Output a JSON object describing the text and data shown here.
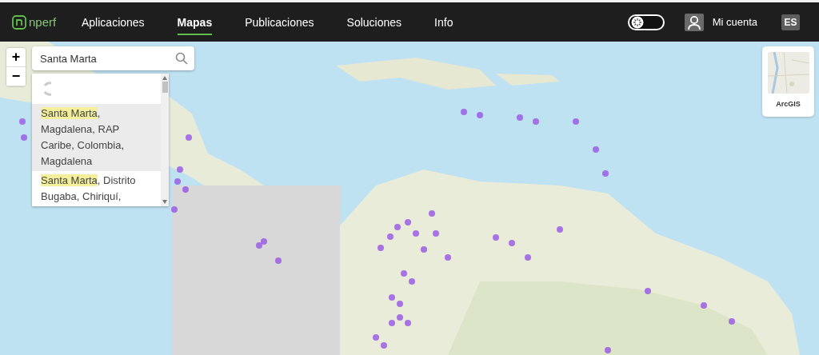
{
  "header": {
    "logo": "nperf",
    "nav": [
      {
        "label": "Aplicaciones",
        "selected": false
      },
      {
        "label": "Mapas",
        "selected": true
      },
      {
        "label": "Publicaciones",
        "selected": false
      },
      {
        "label": "Soluciones",
        "selected": false
      },
      {
        "label": "Info",
        "selected": false
      }
    ],
    "theme_toggle": {
      "on": false
    },
    "account": "Mi cuenta",
    "language": "ES"
  },
  "map": {
    "zoom_in": "+",
    "zoom_out": "−",
    "search": {
      "value": "Santa Marta"
    },
    "results": {
      "loading": true,
      "items": [
        {
          "match": "Santa Marta",
          "rest": ", Magdalena, RAP Caribe, Colombia, Magdalena",
          "selected": true
        },
        {
          "match": "Santa Marta",
          "rest": ", Distrito Bugaba, Chiriquí,",
          "selected": false
        }
      ]
    },
    "basemap": {
      "label": "ArcGIS"
    }
  }
}
